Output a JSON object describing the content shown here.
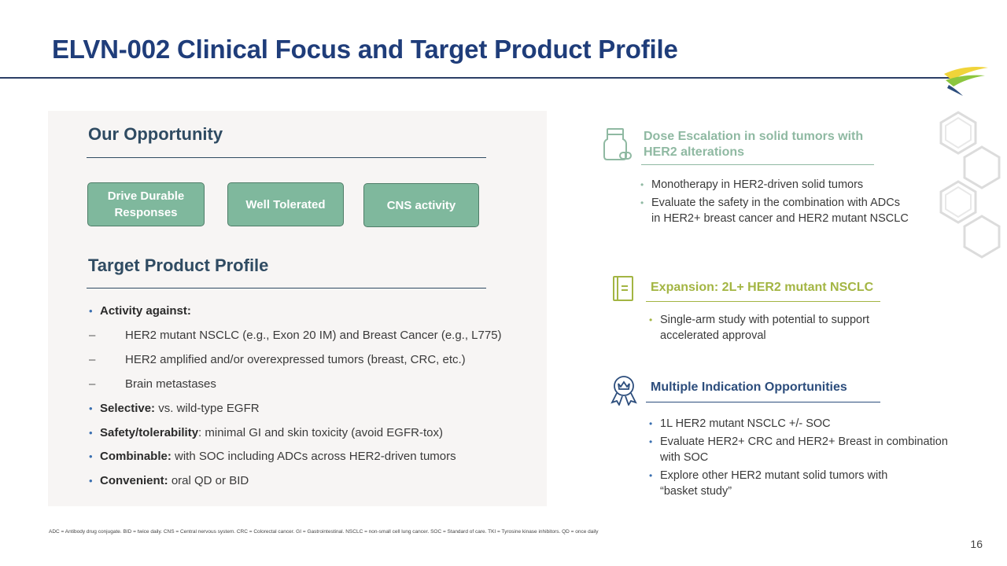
{
  "slide": {
    "title": "ELVN-002 Clinical Focus and Target Product Profile",
    "page_number": "16"
  },
  "opportunity": {
    "heading": "Our Opportunity",
    "pills": [
      "Drive Durable Responses",
      "Well Tolerated",
      "CNS activity"
    ]
  },
  "tpp": {
    "heading": "Target Product Profile",
    "activity_label": "Activity against:",
    "sub_items": [
      "HER2 mutant NSCLC  (e.g., Exon 20 IM) and Breast Cancer (e.g., L775)",
      "HER2 amplified and/or overexpressed tumors (breast, CRC, etc.)",
      "Brain metastases"
    ],
    "items": [
      {
        "label": "Selective:",
        "text": " vs. wild-type EGFR"
      },
      {
        "label": "Safety/tolerability",
        "text": ": minimal GI and skin toxicity (avoid EGFR-tox)"
      },
      {
        "label": "Combinable:",
        "text": " with SOC including ADCs across HER2-driven tumors"
      },
      {
        "label": "Convenient:",
        "text": " oral QD or BID"
      }
    ]
  },
  "right": {
    "dose_escalation": {
      "heading": "Dose Escalation in solid tumors with HER2 alterations",
      "icon": "pill-bottle-icon",
      "color": "#8fb9a2",
      "bullets": [
        "Monotherapy in HER2-driven solid tumors",
        "Evaluate the safety in the combination with ADCs\nin HER2+ breast cancer and HER2 mutant NSCLC"
      ]
    },
    "expansion": {
      "heading": "Expansion: 2L+ HER2 mutant NSCLC",
      "icon": "document-icon",
      "color": "#a3b543",
      "bullets": [
        "Single-arm study with potential to support\naccelerated approval"
      ]
    },
    "multiple": {
      "heading": "Multiple Indication Opportunities",
      "icon": "award-ribbon-icon",
      "color": "#2c4d7c",
      "bullets": [
        "1L HER2 mutant NSCLC +/- SOC",
        "Evaluate HER2+ CRC and HER2+ Breast in combination\nwith SOC",
        "Explore other HER2 mutant solid tumors with\n“basket study”"
      ]
    }
  },
  "footnote": "ADC = Antibody drug conjugate. BID = twice daily. CNS = Central nervous system. CRC = Colorectal cancer. GI = Gastrointestinal.  NSCLC = non-small cell lung cancer. SOC = Standard of care. TKI = Tyrosine kinase inhibitors. QD = once daily",
  "colors": {
    "title": "#1f3d7a",
    "heading": "#2f4b62",
    "pill_fill": "#7fb89d",
    "bullet": "#3a6fb0"
  }
}
